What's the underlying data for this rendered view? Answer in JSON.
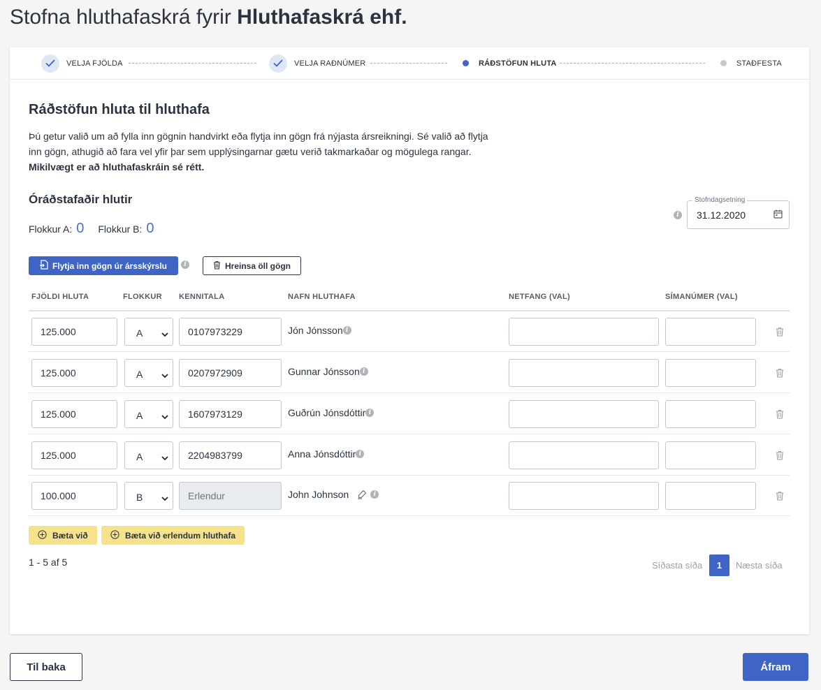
{
  "header": {
    "title_prefix": "Stofna hluthafaskrá fyrir",
    "company": "Hluthafaskrá ehf."
  },
  "stepper": {
    "steps": [
      {
        "label": "VELJA FJÖLDA",
        "state": "done"
      },
      {
        "label": "VELJA RAÐNÚMER",
        "state": "done"
      },
      {
        "label": "RÁÐSTÖFUN HLUTA",
        "state": "active"
      },
      {
        "label": "STAÐFESTA",
        "state": "pending"
      }
    ]
  },
  "section": {
    "title": "Ráðstöfun hluta til hluthafa",
    "intro": "Þú getur valið um að fylla inn gögnin handvirkt eða flytja inn gögn frá nýjasta ársreikningi. Sé valið að flytja inn gögn, athugið að fara vel yfir þar sem upplýsingarnar gætu verið takmarkaðar og mögulega rangar.",
    "intro_bold": "Mikilvægt er að hluthafaskráin sé rétt."
  },
  "unallocated": {
    "title": "Óráðstafaðir hlutir",
    "class_a_label": "Flokkur A:",
    "class_a_value": "0",
    "class_b_label": "Flokkur B:",
    "class_b_value": "0"
  },
  "date_field": {
    "label": "Stofndagsetning",
    "value": "31.12.2020"
  },
  "actions": {
    "import_label": "Flytja inn gögn úr ársskýrslu",
    "clear_label": "Hreinsa öll gögn",
    "add_label": "Bæta við",
    "add_foreign_label": "Bæta við erlendum hluthafa"
  },
  "table": {
    "headers": {
      "shares": "FJÖLDI HLUTA",
      "class": "FLOKKUR",
      "kennitala": "KENNITALA",
      "name": "NAFN HLUTHAFA",
      "email": "NETFANG (VAL)",
      "phone": "SÍMANÚMER (VAL)"
    },
    "rows": [
      {
        "shares": "125.000",
        "class": "A",
        "kennitala": "0107973229",
        "name": "Jón Jónsson",
        "email": "",
        "phone": ""
      },
      {
        "shares": "125.000",
        "class": "A",
        "kennitala": "0207972909",
        "name": "Gunnar Jónsson",
        "email": "",
        "phone": ""
      },
      {
        "shares": "125.000",
        "class": "A",
        "kennitala": "1607973129",
        "name": "Guðrún Jónsdóttir",
        "email": "",
        "phone": ""
      },
      {
        "shares": "125.000",
        "class": "A",
        "kennitala": "2204983799",
        "name": "Anna Jónsdóttir",
        "email": "",
        "phone": ""
      },
      {
        "shares": "100.000",
        "class": "B",
        "kennitala": "Erlendur",
        "name": "John Johnson",
        "email": "",
        "phone": ""
      }
    ]
  },
  "pagination": {
    "range": "1 - 5 af 5",
    "prev_label": "Síðasta síða",
    "current_page": "1",
    "next_label": "Næsta síða"
  },
  "footer": {
    "back_label": "Til baka",
    "next_label": "Áfram"
  },
  "colors": {
    "primary": "#3e64c5",
    "accent_yellow": "#f5e28a",
    "step_done_bg": "#dfe6f4"
  }
}
